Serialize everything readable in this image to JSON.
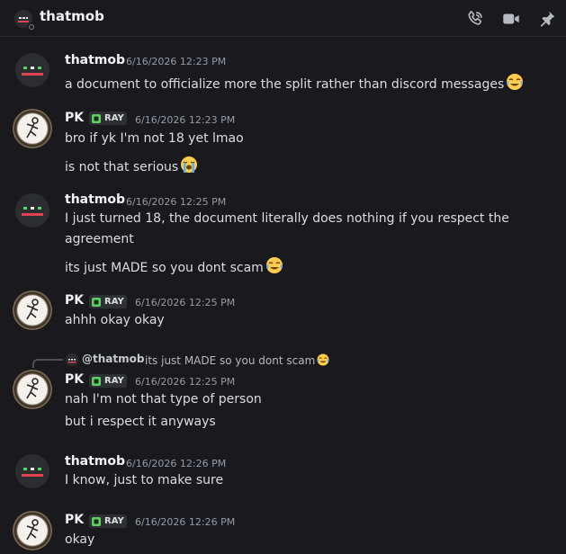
{
  "header": {
    "channel_name": "thatmob",
    "icons": [
      "voice-call-icon",
      "video-call-icon",
      "pinned-messages-icon"
    ]
  },
  "colors": {
    "background": "#1a1a1e",
    "text": "#dbdee1",
    "muted": "#949ba4",
    "tag_icon": "#5bd35b",
    "avatar_red": "#e0434f",
    "avatar_green": "#4fdc60"
  },
  "messages": [
    {
      "author": "thatmob",
      "time": "6/16/2026 12:23 PM",
      "lines": [
        "a document to officialize more the split rather than discord messages"
      ]
    },
    {
      "author": "PK",
      "tag": "RAY",
      "time": "6/16/2026 12:23 PM",
      "lines": [
        "bro if yk I'm not 18 yet lmao",
        "is not that serious"
      ]
    },
    {
      "author": "thatmob",
      "time": "6/16/2026 12:25 PM",
      "lines": [
        "I just turned 18, the document literally does nothing if you respect the",
        "agreement",
        "its just MADE so you dont scam"
      ]
    },
    {
      "author": "PK",
      "tag": "RAY",
      "time": "6/16/2026 12:25 PM",
      "lines": [
        "ahhh okay okay"
      ]
    },
    {
      "author": "PK",
      "tag": "RAY",
      "time": "6/16/2026 12:25 PM",
      "reply": {
        "name": "@thatmob",
        "text": "its just MADE so you dont scam"
      },
      "lines": [
        "nah I'm not that type of person",
        "but i respect it anyways"
      ]
    },
    {
      "author": "thatmob",
      "time": "6/16/2026 12:26 PM",
      "lines": [
        "I know, just to make sure"
      ]
    },
    {
      "author": "PK",
      "tag": "RAY",
      "time": "6/16/2026 12:26 PM",
      "lines": [
        "okay"
      ]
    }
  ]
}
